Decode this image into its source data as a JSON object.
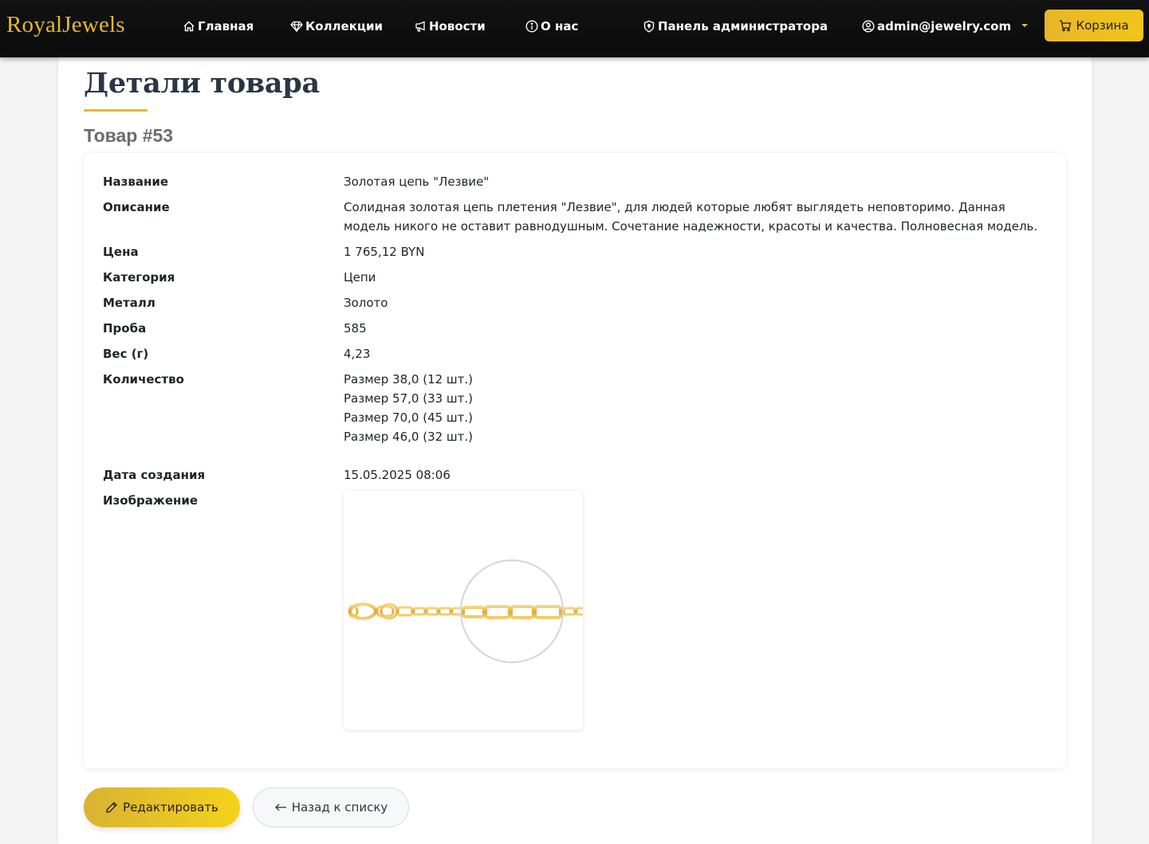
{
  "brand": "RoyalJewels",
  "nav": {
    "home": "Главная",
    "collections": "Коллекции",
    "news": "Новости",
    "about": "О нас",
    "admin_panel": "Панель администратора",
    "user_email": "admin@jewelry.com",
    "cart": "Корзина"
  },
  "page": {
    "title": "Детали товара",
    "subtitle": "Товар #53"
  },
  "details": {
    "name_label": "Название",
    "name_value": "Золотая цепь \"Лезвие\"",
    "description_label": "Описание",
    "description_value": "Солидная золотая цепь плетения \"Лезвие\", для людей которые любят выглядеть неповторимо. Данная модель никого не оставит равнодушным. Сочетание надежности, красоты и качества. Полновесная модель.",
    "price_label": "Цена",
    "price_value": "1 765,12 BYN",
    "category_label": "Категория",
    "category_value": "Цепи",
    "metal_label": "Металл",
    "metal_value": "Золото",
    "purity_label": "Проба",
    "purity_value": "585",
    "weight_label": "Вес (г)",
    "weight_value": "4,23",
    "quantity_label": "Количество",
    "quantity_values": [
      "Размер 38,0 (12 шт.)",
      "Размер 57,0 (33 шт.)",
      "Размер 70,0 (45 шт.)",
      "Размер 46,0 (32 шт.)"
    ],
    "created_label": "Дата создания",
    "created_value": "15.05.2025 08:06",
    "image_label": "Изображение"
  },
  "actions": {
    "edit": "Редактировать",
    "back": "Назад к списку"
  },
  "colors": {
    "accent_gold": "#e6b92a",
    "navbar_bg": "#111111",
    "title_color": "#2a3547"
  }
}
